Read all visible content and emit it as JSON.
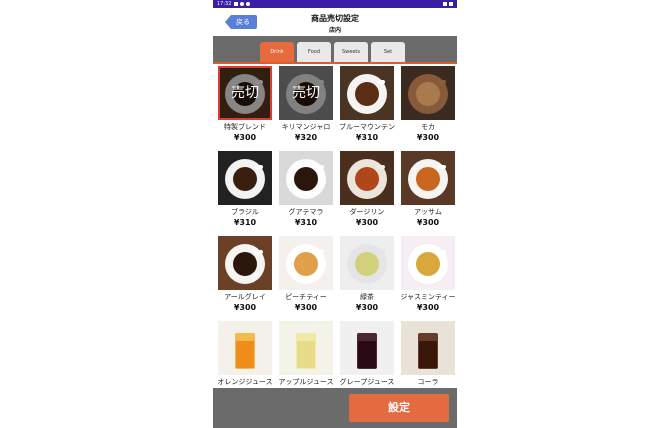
{
  "status_bar": {
    "time": "17:32"
  },
  "header": {
    "back_label": "戻る",
    "title": "商品売切設定",
    "subtitle": "店内"
  },
  "tabs": [
    {
      "label": "Drink",
      "active": true
    },
    {
      "label": "Food",
      "active": false
    },
    {
      "label": "Sweets",
      "active": false
    },
    {
      "label": "Set",
      "active": false
    }
  ],
  "sold_out_label": "売切",
  "products": [
    {
      "name": "特製ブレンド",
      "price": "¥300",
      "sold_out": true,
      "selected": true,
      "bg": "#5a3a22",
      "cup": "#ffffff",
      "drink": "#2b170c"
    },
    {
      "name": "キリマンジャロ",
      "price": "¥320",
      "sold_out": true,
      "selected": false,
      "bg": "#8a8a8a",
      "cup": "#f1f1f1",
      "drink": "#2b170c"
    },
    {
      "name": "ブルーマウンテン",
      "price": "¥310",
      "sold_out": false,
      "selected": false,
      "bg": "#4a3424",
      "cup": "#ffffff",
      "drink": "#5a2e14"
    },
    {
      "name": "モカ",
      "price": "¥300",
      "sold_out": false,
      "selected": false,
      "bg": "#3a2a20",
      "cup": "#8b5e3c",
      "drink": "#a97a4e"
    },
    {
      "name": "ブラジル",
      "price": "¥310",
      "sold_out": false,
      "selected": false,
      "bg": "#222222",
      "cup": "#ffffff",
      "drink": "#3a1f0f"
    },
    {
      "name": "グアテマラ",
      "price": "¥310",
      "sold_out": false,
      "selected": false,
      "bg": "#d9d9d9",
      "cup": "#ffffff",
      "drink": "#2a160a"
    },
    {
      "name": "ダージリン",
      "price": "¥300",
      "sold_out": false,
      "selected": false,
      "bg": "#4a2e1e",
      "cup": "#f4efe6",
      "drink": "#b0471a"
    },
    {
      "name": "アッサム",
      "price": "¥300",
      "sold_out": false,
      "selected": false,
      "bg": "#5a3a26",
      "cup": "#ffffff",
      "drink": "#c9661f"
    },
    {
      "name": "アールグレイ",
      "price": "¥300",
      "sold_out": false,
      "selected": false,
      "bg": "#6a4126",
      "cup": "#ffffff",
      "drink": "#2b170c"
    },
    {
      "name": "ピーチティー",
      "price": "¥300",
      "sold_out": false,
      "selected": false,
      "bg": "#f3f0ee",
      "cup": "#ffffff",
      "drink": "#e0a04a"
    },
    {
      "name": "緑茶",
      "price": "¥300",
      "sold_out": false,
      "selected": false,
      "bg": "#eeeeee",
      "cup": "#e4e4e4",
      "drink": "#d2d07a"
    },
    {
      "name": "ジャスミンティー",
      "price": "¥300",
      "sold_out": false,
      "selected": false,
      "bg": "#f6eef4",
      "cup": "#ffffff",
      "drink": "#d9a83a"
    },
    {
      "name": "オレンジジュース",
      "price": "",
      "sold_out": false,
      "selected": false,
      "bg": "#f4f1ea",
      "cup": "#f3b53a",
      "drink": "#f08c1a"
    },
    {
      "name": "アップルジュース",
      "price": "",
      "sold_out": false,
      "selected": false,
      "bg": "#f3f3e8",
      "cup": "#efe9a0",
      "drink": "#e8dc8a"
    },
    {
      "name": "グレープジュース",
      "price": "",
      "sold_out": false,
      "selected": false,
      "bg": "#f0f0f0",
      "cup": "#3a0f20",
      "drink": "#2a0a14"
    },
    {
      "name": "コーラ",
      "price": "",
      "sold_out": false,
      "selected": false,
      "bg": "#e8e2d8",
      "cup": "#5a2a1a",
      "drink": "#3a160a"
    }
  ],
  "footer": {
    "set_label": "設定"
  }
}
